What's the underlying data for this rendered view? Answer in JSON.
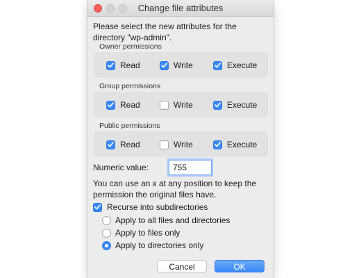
{
  "window": {
    "title": "Change file attributes"
  },
  "intro_text": "Please select the new attributes for the directory \"wp-admin\".",
  "groups": [
    {
      "label": "Owner permissions",
      "read": {
        "label": "Read",
        "checked": true
      },
      "write": {
        "label": "Write",
        "checked": true
      },
      "execute": {
        "label": "Execute",
        "checked": true
      }
    },
    {
      "label": "Group permissions",
      "read": {
        "label": "Read",
        "checked": true
      },
      "write": {
        "label": "Write",
        "checked": false
      },
      "execute": {
        "label": "Execute",
        "checked": true
      }
    },
    {
      "label": "Public permissions",
      "read": {
        "label": "Read",
        "checked": true
      },
      "write": {
        "label": "Write",
        "checked": false
      },
      "execute": {
        "label": "Execute",
        "checked": true
      }
    }
  ],
  "numeric": {
    "label": "Numeric value:",
    "value": "755"
  },
  "hint_text": "You can use an x at any position to keep the permission the original files have.",
  "recurse": {
    "label": "Recurse into subdirectories",
    "checked": true
  },
  "apply_options": [
    {
      "label": "Apply to all files and directories",
      "selected": false
    },
    {
      "label": "Apply to files only",
      "selected": false
    },
    {
      "label": "Apply to directories only",
      "selected": true
    }
  ],
  "buttons": {
    "cancel": "Cancel",
    "ok": "OK"
  },
  "colors": {
    "accent": "#3b89f5",
    "close": "#fc605b",
    "dialog_bg": "#ececec",
    "group_bg": "#e2e2e2"
  }
}
